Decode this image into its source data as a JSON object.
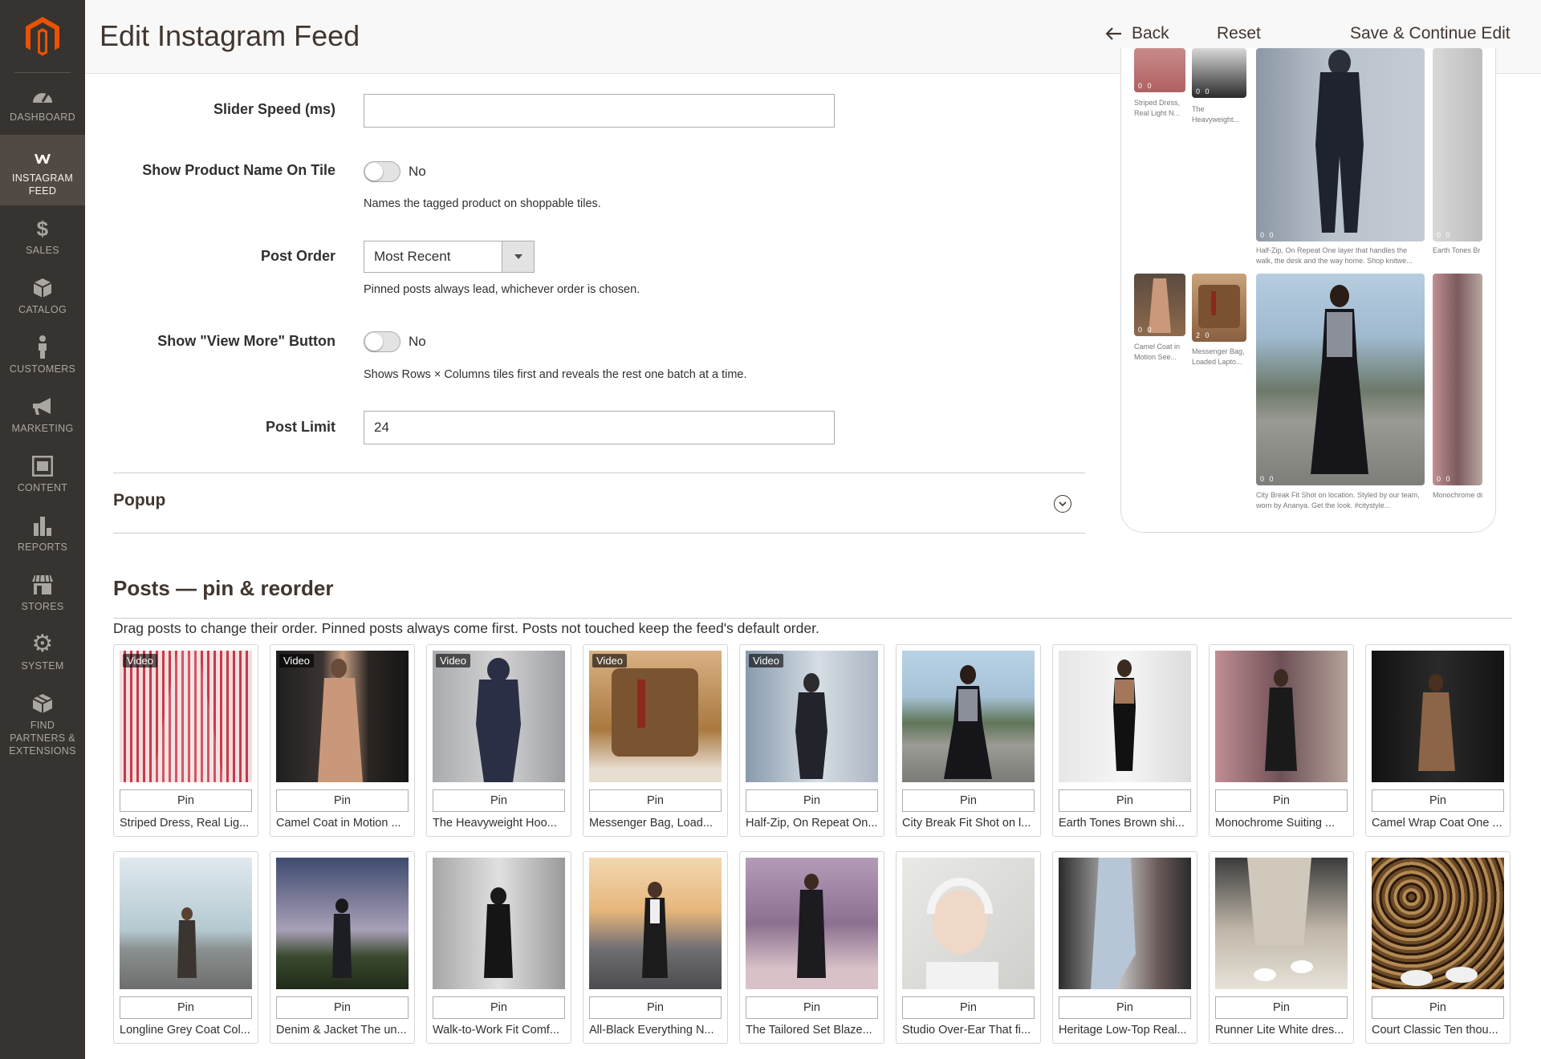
{
  "header": {
    "title": "Edit Instagram Feed",
    "back_label": "Back",
    "reset_label": "Reset",
    "save_label": "Save & Continue Edit"
  },
  "sidebar": {
    "items": [
      {
        "label": "DASHBOARD",
        "icon": "dashboard-icon"
      },
      {
        "label": "INSTAGRAM FEED",
        "icon": "instagram-feed-icon",
        "active": true
      },
      {
        "label": "SALES",
        "icon": "dollar-icon"
      },
      {
        "label": "CATALOG",
        "icon": "cube-icon"
      },
      {
        "label": "CUSTOMERS",
        "icon": "person-icon"
      },
      {
        "label": "MARKETING",
        "icon": "megaphone-icon"
      },
      {
        "label": "CONTENT",
        "icon": "layout-icon"
      },
      {
        "label": "REPORTS",
        "icon": "bar-chart-icon"
      },
      {
        "label": "STORES",
        "icon": "storefront-icon"
      },
      {
        "label": "SYSTEM",
        "icon": "gear-icon"
      },
      {
        "label": "FIND PARTNERS & EXTENSIONS",
        "icon": "extensions-icon"
      }
    ]
  },
  "form": {
    "slider_speed_label": "Slider Speed (ms)",
    "slider_speed_value": "",
    "show_product_name_label": "Show Product Name On Tile",
    "show_product_name_value": "No",
    "show_product_name_note": "Names the tagged product on shoppable tiles.",
    "post_order_label": "Post Order",
    "post_order_value": "Most Recent",
    "post_order_note": "Pinned posts always lead, whichever order is chosen.",
    "view_more_label": "Show \"View More\" Button",
    "view_more_value": "No",
    "view_more_note": "Shows Rows × Columns tiles first and reveals the rest one batch at a time.",
    "post_limit_label": "Post Limit",
    "post_limit_value": "24",
    "popup_section": "Popup"
  },
  "preview": {
    "captions": [
      "Striped Dress, Real Light N...",
      "The Heavyweight...",
      "Half-Zip, On Repeat One layer that handles the walk, the desk and the way home. Shop knitwe...",
      "Earth Tones Br else needed. L",
      "Camel Coat in Motion See...",
      "Messenger Bag, Loaded Lapto...",
      "City Break Fit Shot on location. Styled by our team, worn by Ananya. Get the look. #citystyle...",
      "Monochrome done. Shop th"
    ],
    "counts": [
      "0 0",
      "0 0",
      "0 0",
      "0 0",
      "0 0",
      "2 0",
      "0 0",
      "0 0"
    ]
  },
  "posts": {
    "title": "Posts — pin & reorder",
    "description": "Drag posts to change their order. Pinned posts always come first. Posts not touched keep the feed's default order.",
    "pin_label": "Pin",
    "video_label": "Video",
    "items": [
      {
        "caption": "Striped Dress, Real Lig...",
        "video": true
      },
      {
        "caption": "Camel Coat in Motion ...",
        "video": true
      },
      {
        "caption": "The Heavyweight Hoo...",
        "video": true
      },
      {
        "caption": "Messenger Bag, Load...",
        "video": true
      },
      {
        "caption": "Half-Zip, On Repeat On...",
        "video": true
      },
      {
        "caption": "City Break Fit Shot on l...",
        "video": false
      },
      {
        "caption": "Earth Tones Brown shi...",
        "video": false
      },
      {
        "caption": "Monochrome Suiting ...",
        "video": false
      },
      {
        "caption": "Camel Wrap Coat One ...",
        "video": false
      },
      {
        "caption": "Longline Grey Coat Col...",
        "video": false
      },
      {
        "caption": "Denim & Jacket The un...",
        "video": false
      },
      {
        "caption": "Walk-to-Work Fit Comf...",
        "video": false
      },
      {
        "caption": "All-Black Everything N...",
        "video": false
      },
      {
        "caption": "The Tailored Set Blaze...",
        "video": false
      },
      {
        "caption": "Studio Over-Ear That fi...",
        "video": false
      },
      {
        "caption": "Heritage Low-Top Real...",
        "video": false
      },
      {
        "caption": "Runner Lite White dres...",
        "video": false
      },
      {
        "caption": "Court Classic Ten thou...",
        "video": false
      }
    ]
  },
  "colors": {
    "sidebar_bg": "#373330",
    "sidebar_active": "#514943",
    "brand_orange": "#eb5202"
  }
}
